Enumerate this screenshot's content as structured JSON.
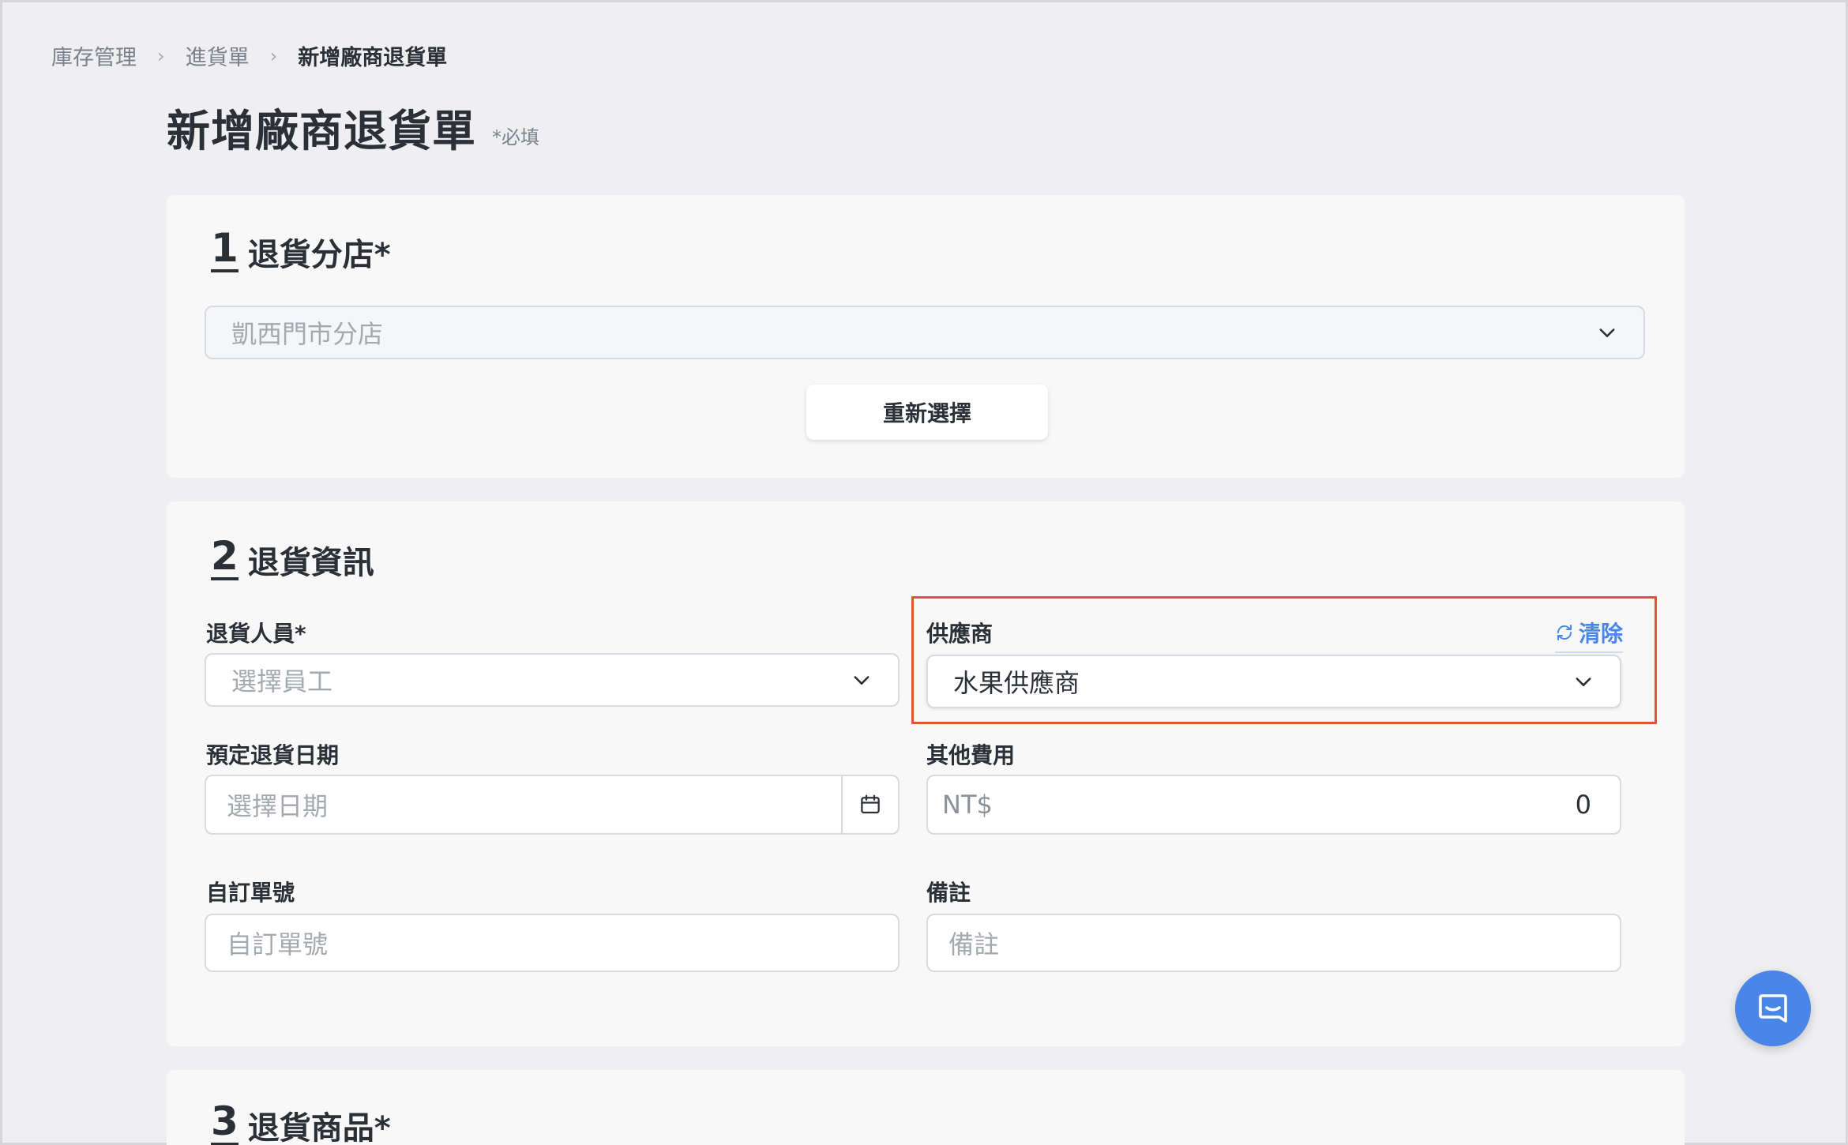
{
  "breadcrumb": {
    "items": [
      "庫存管理",
      "進貨單",
      "新增廠商退貨單"
    ]
  },
  "page": {
    "title": "新增廠商退貨單",
    "required_note": "*必填"
  },
  "section1": {
    "number": "1",
    "title": "退貨分店*",
    "branch_select_value": "凱西門市分店",
    "reselect_button": "重新選擇"
  },
  "section2": {
    "number": "2",
    "title": "退貨資訊",
    "staff": {
      "label": "退貨人員*",
      "placeholder": "選擇員工"
    },
    "supplier": {
      "label": "供應商",
      "clear_label": "清除",
      "value": "水果供應商"
    },
    "date": {
      "label": "預定退貨日期",
      "placeholder": "選擇日期"
    },
    "other_fee": {
      "label": "其他費用",
      "prefix": "NT$",
      "value": "0"
    },
    "custom_no": {
      "label": "自訂單號",
      "placeholder": "自訂單號"
    },
    "note": {
      "label": "備註",
      "placeholder": "備註"
    }
  },
  "section3": {
    "number": "3",
    "title": "退貨商品*"
  },
  "colors": {
    "accent": "#4a86e8",
    "highlight": "#e0533a",
    "background": "#efeff1",
    "card": "#f8f8f9"
  },
  "icons": {
    "breadcrumb_separator": "chevron-right-icon",
    "select_arrow": "chevron-down-icon",
    "calendar": "calendar-icon",
    "clear": "refresh-icon",
    "chat": "chat-icon"
  }
}
